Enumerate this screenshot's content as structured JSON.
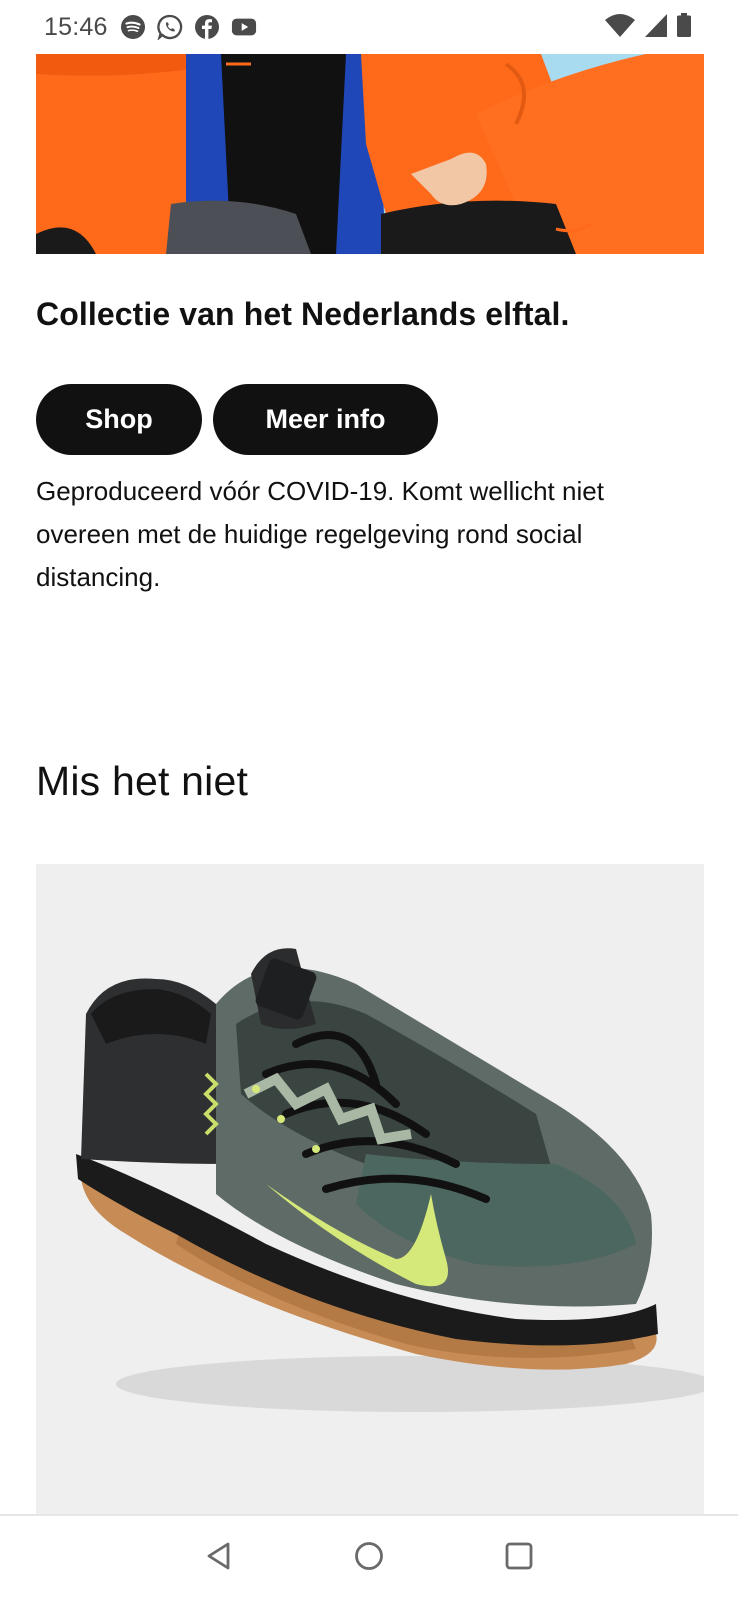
{
  "status_bar": {
    "time": "15:46",
    "app_icons": [
      "spotify-icon",
      "whatsapp-icon",
      "facebook-icon",
      "youtube-icon"
    ],
    "system_icons": [
      "wifi-icon",
      "cellular-signal-icon",
      "battery-icon"
    ]
  },
  "hero": {
    "image": "dutch-national-team-players-photo",
    "title": "Collectie van het Nederlands elftal.",
    "buttons": {
      "shop_label": "Shop",
      "info_label": "Meer info"
    },
    "disclaimer": "Geproduceerd vóór COVID-19. Komt wellicht niet overeen met de huidige regelgeving rond social distancing."
  },
  "section": {
    "title": "Mis het niet",
    "product_image": "nike-metcon-6-shoe-photo"
  },
  "nav_bar": {
    "icons": [
      "back-icon",
      "home-icon",
      "recents-icon"
    ]
  },
  "colors": {
    "button_bg": "#111111",
    "button_text": "#ffffff",
    "jersey_orange": "#ff6a1a",
    "card_bg": "#efefef"
  }
}
